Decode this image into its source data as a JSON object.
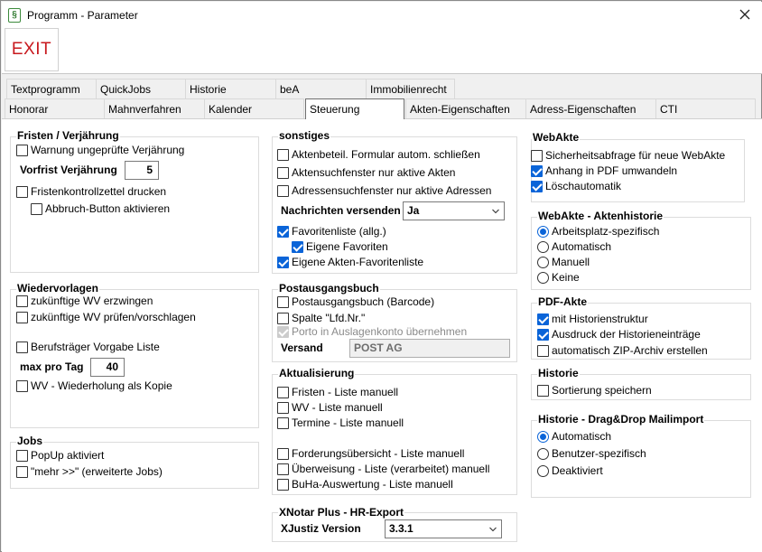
{
  "window": {
    "title": "Programm - Parameter",
    "app_icon_glyph": "§"
  },
  "toolbar": {
    "exit_label": "EXIT"
  },
  "tabs_row1": [
    "Textprogramm",
    "QuickJobs",
    "Historie",
    "beA",
    "Immobilienrecht"
  ],
  "tabs_row2": [
    "Honorar",
    "Mahnverfahren",
    "Kalender",
    "Steuerung",
    "Akten-Eigenschaften",
    "Adress-Eigenschaften",
    "CTI"
  ],
  "active_tab": "Steuerung",
  "fristen": {
    "title": "Fristen / Verjährung",
    "warnung": "Warnung ungeprüfte Verjährung",
    "vorfrist_label": "Vorfrist Verjährung",
    "vorfrist_value": "5",
    "kontrollzettel": "Fristenkontrollzettel drucken",
    "abbruch": "Abbruch-Button aktivieren"
  },
  "wiedervorlagen": {
    "title": "Wiedervorlagen",
    "erzwingen": "zukünftige WV erzwingen",
    "pruefen": "zukünftige WV prüfen/vorschlagen",
    "berufstraeger": "Berufsträger Vorgabe Liste",
    "max_label": "max pro Tag",
    "max_value": "40",
    "wiederholung": "WV - Wiederholung als Kopie"
  },
  "jobs": {
    "title": "Jobs",
    "popup": "PopUp aktiviert",
    "mehr": "\"mehr >>\" (erweiterte Jobs)"
  },
  "sonstiges": {
    "title": "sonstiges",
    "aktenbeteil": "Aktenbeteil. Formular autom. schließen",
    "aktensuch": "Aktensuchfenster nur aktive Akten",
    "adressen": "Adressensuchfenster nur aktive Adressen",
    "nachrichten_label": "Nachrichten versenden",
    "nachrichten_value": "Ja",
    "favoriten": "Favoritenliste (allg.)",
    "eigene_favoriten": "Eigene Favoriten",
    "akten_favoriten": "Eigene Akten-Favoritenliste"
  },
  "postausgang": {
    "title": "Postausgangsbuch",
    "barcode": "Postausgangsbuch (Barcode)",
    "spalte": "Spalte \"Lfd.Nr.\"",
    "porto": "Porto in Auslagenkonto übernehmen",
    "versand_label": "Versand",
    "versand_value": "POST AG"
  },
  "aktualisierung": {
    "title": "Aktualisierung",
    "fristen": "Fristen - Liste manuell",
    "wv": "WV - Liste manuell",
    "termine": "Termine - Liste manuell",
    "forderung": "Forderungsübersicht - Liste manuell",
    "ueberweisung": "Überweisung - Liste (verarbeitet) manuell",
    "buha": "BuHa-Auswertung - Liste manuell"
  },
  "xnotar": {
    "title": "XNotar Plus - HR-Export",
    "version_label": "XJustiz Version",
    "version_value": "3.3.1"
  },
  "webakte": {
    "title": "WebAkte",
    "sicherheit": "Sicherheitsabfrage für neue WebAkte",
    "anhang": "Anhang in PDF umwandeln",
    "loesch": "Löschautomatik"
  },
  "webakte_historie": {
    "title": "WebAkte - Aktenhistorie",
    "options": [
      "Arbeitsplatz-spezifisch",
      "Automatisch",
      "Manuell",
      "Keine"
    ],
    "selected": "Arbeitsplatz-spezifisch"
  },
  "pdf_akte": {
    "title": "PDF-Akte",
    "historie": "mit Historienstruktur",
    "ausdruck": "Ausdruck der Historieneinträge",
    "zip": "automatisch ZIP-Archiv erstellen"
  },
  "historie": {
    "title": "Historie",
    "sortierung": "Sortierung speichern"
  },
  "mailimport": {
    "title": "Historie - Drag&Drop Mailimport",
    "options": [
      "Automatisch",
      "Benutzer-spezifisch",
      "Deaktiviert"
    ],
    "selected": "Automatisch"
  },
  "colors": {
    "exit_red": "#c8191e",
    "check_blue": "#0a64d8"
  }
}
